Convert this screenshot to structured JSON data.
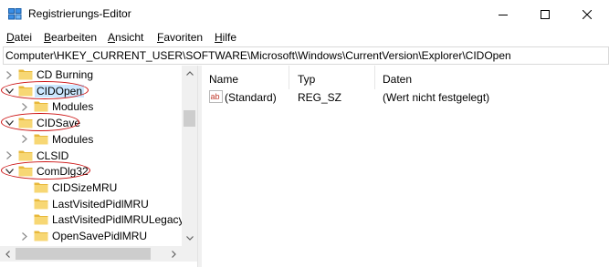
{
  "window": {
    "title": "Registrierungs-Editor",
    "controls": {
      "minimize": "—",
      "maximize": "☐",
      "close": "✕"
    }
  },
  "menu": {
    "items": [
      {
        "label_u": "D",
        "label_rest": "atei"
      },
      {
        "label_u": "B",
        "label_rest": "earbeiten"
      },
      {
        "label_u": "A",
        "label_rest": "nsicht"
      },
      {
        "label_u": "F",
        "label_rest": "avoriten"
      },
      {
        "label_u": "H",
        "label_rest": "ilfe"
      }
    ]
  },
  "address": {
    "path": "Computer\\HKEY_CURRENT_USER\\SOFTWARE\\Microsoft\\Windows\\CurrentVersion\\Explorer\\CIDOpen"
  },
  "tree": {
    "items": [
      {
        "label": "CD Burning",
        "expander": "right",
        "level": 0,
        "selected": false,
        "circled": false
      },
      {
        "label": "CIDOpen",
        "expander": "down",
        "level": 0,
        "selected": true,
        "circled": true
      },
      {
        "label": "Modules",
        "expander": "right",
        "level": 1,
        "selected": false,
        "circled": false
      },
      {
        "label": "CIDSave",
        "expander": "down",
        "level": 0,
        "selected": false,
        "circled": true
      },
      {
        "label": "Modules",
        "expander": "right",
        "level": 1,
        "selected": false,
        "circled": false
      },
      {
        "label": "CLSID",
        "expander": "right",
        "level": 0,
        "selected": false,
        "circled": false
      },
      {
        "label": "ComDlg32",
        "expander": "down",
        "level": 0,
        "selected": false,
        "circled": true
      },
      {
        "label": "CIDSizeMRU",
        "expander": "none",
        "level": 1,
        "selected": false,
        "circled": false
      },
      {
        "label": "LastVisitedPidlMRU",
        "expander": "none",
        "level": 1,
        "selected": false,
        "circled": false
      },
      {
        "label": "LastVisitedPidlMRULegacy",
        "expander": "none",
        "level": 1,
        "selected": false,
        "circled": false
      },
      {
        "label": "OpenSavePidlMRU",
        "expander": "right",
        "level": 1,
        "selected": false,
        "circled": false
      }
    ]
  },
  "values": {
    "columns": {
      "name": "Name",
      "type": "Typ",
      "data": "Daten"
    },
    "rows": [
      {
        "icon": "string-value-icon",
        "name": "(Standard)",
        "type": "REG_SZ",
        "data": "(Wert nicht festgelegt)"
      }
    ]
  },
  "colors": {
    "folder": "#e8b83a",
    "folder_front": "#f7d774",
    "selection": "#cce8ff",
    "annotation": "#cc1111"
  }
}
